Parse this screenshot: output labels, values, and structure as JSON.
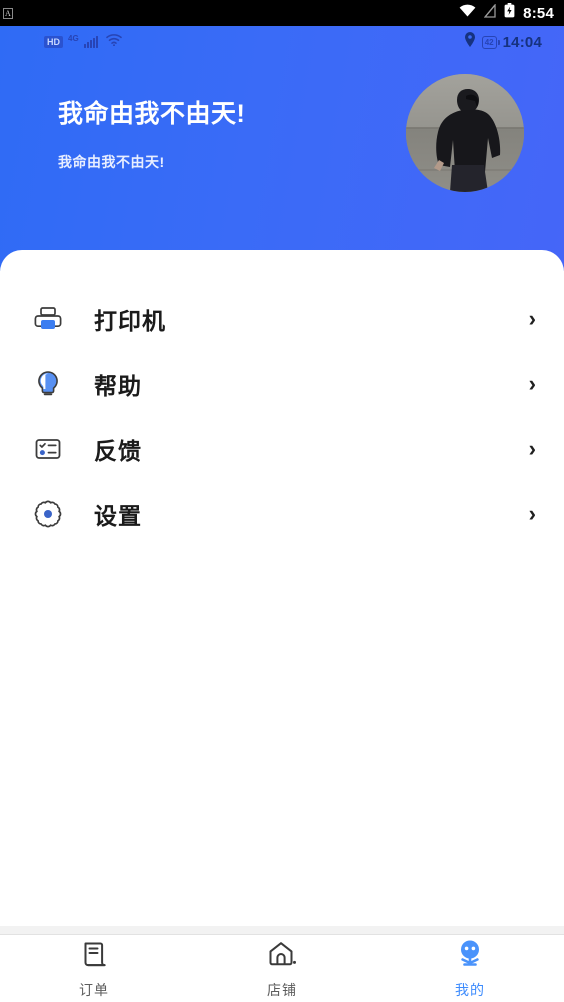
{
  "system_status_bar": {
    "left_badge": "A",
    "time": "8:54",
    "icons": [
      "wifi-icon",
      "signal-off-icon",
      "battery-charging-icon"
    ]
  },
  "app_status_bar": {
    "hd_label": "HD",
    "network_label": "4G",
    "battery_level": "42",
    "time": "14:04",
    "icons": [
      "hd-icon",
      "signal-bars-icon",
      "wifi-icon",
      "location-pin-icon",
      "battery-icon"
    ]
  },
  "header": {
    "title": "我命由我不由天!",
    "subtitle": "我命由我不由天!",
    "avatar_alt": "user-avatar",
    "gradient_start": "#2f6bf5",
    "gradient_end": "#4566f8"
  },
  "menu": {
    "items": [
      {
        "label": "打印机",
        "icon": "printer-icon",
        "chevron": "›"
      },
      {
        "label": "帮助",
        "icon": "lightbulb-icon",
        "chevron": "›"
      },
      {
        "label": "反馈",
        "icon": "feedback-form-icon",
        "chevron": "›"
      },
      {
        "label": "设置",
        "icon": "gear-icon",
        "chevron": "›"
      }
    ]
  },
  "bottom_nav": {
    "active_color": "#3d8bfd",
    "items": [
      {
        "label": "订单",
        "icon": "order-receipt-icon",
        "active": false
      },
      {
        "label": "店铺",
        "icon": "store-house-icon",
        "active": false
      },
      {
        "label": "我的",
        "icon": "profile-person-icon",
        "active": true
      }
    ]
  }
}
